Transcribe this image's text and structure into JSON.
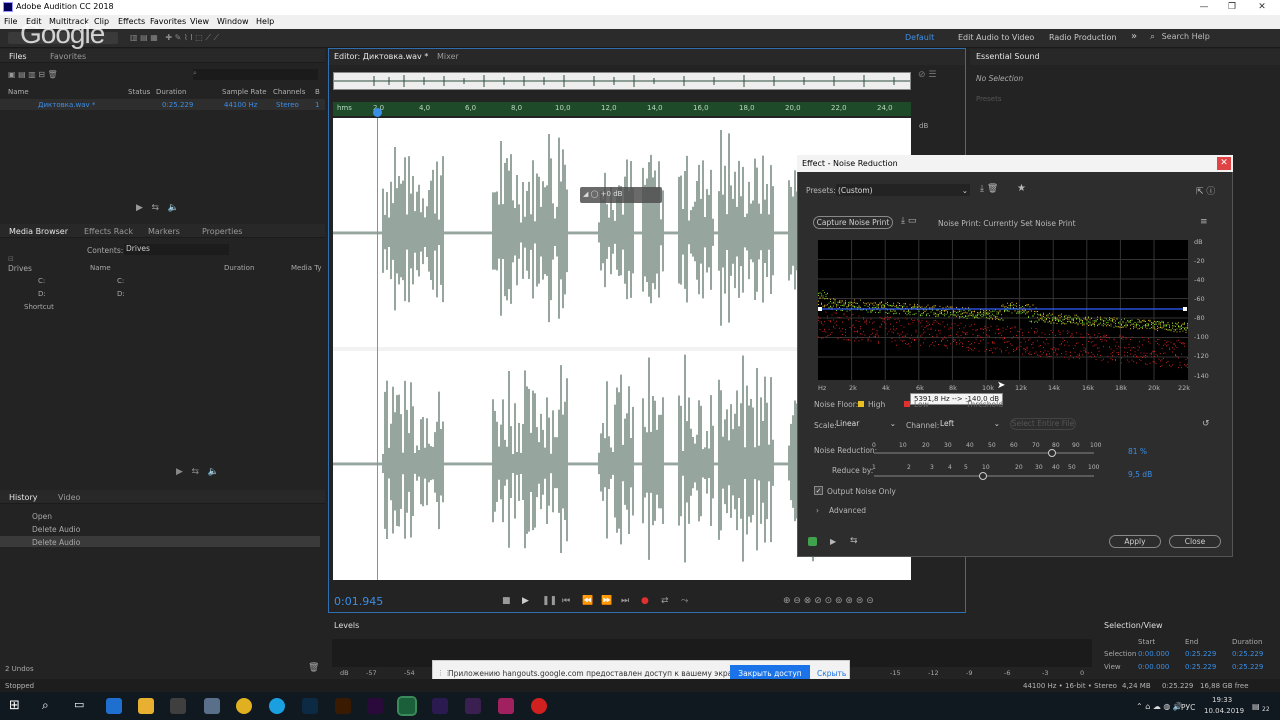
{
  "window": {
    "title": "Adobe Audition CC 2018",
    "minimize": "—",
    "maximize": "❐",
    "close": "✕"
  },
  "menu": [
    "File",
    "Edit",
    "Multitrack",
    "Clip",
    "Effects",
    "Favorites",
    "View",
    "Window",
    "Help"
  ],
  "toolbar": {
    "workspace_default": "Default",
    "workspace_edit": "Edit Audio to Video",
    "workspace_radio": "Radio Production",
    "overflow": "»",
    "search_placeholder": "Search Help",
    "overlay_text": "Google"
  },
  "files_panel": {
    "tab_files": "Files",
    "tab_favorites": "Favorites",
    "col_name": "Name",
    "col_status": "Status",
    "col_duration": "Duration",
    "col_sample_rate": "Sample Rate",
    "col_channels": "Channels",
    "col_bits": "B",
    "row": {
      "name": "Диктовка.wav *",
      "duration": "0:25.229",
      "sample_rate": "44100 Hz",
      "channels": "Stereo",
      "bits": "1"
    }
  },
  "media_browser": {
    "tab_media": "Media Browser",
    "tab_effects": "Effects Rack",
    "tab_markers": "Markers",
    "tab_properties": "Properties",
    "contents_label": "Contents:",
    "contents_value": "Drives",
    "tree": [
      "Drives",
      "C:",
      "D:",
      "Shortcut"
    ],
    "col_name": "Name",
    "col_duration": "Duration",
    "col_media": "Media Ty",
    "items": [
      "C:",
      "D:"
    ]
  },
  "history": {
    "tab_history": "History",
    "tab_video": "Video",
    "items": [
      "Open",
      "Delete Audio",
      "Delete Audio"
    ],
    "undos": "2 Undos"
  },
  "editor": {
    "tab_editor": "Editor: Диктовка.wav *",
    "tab_mixer": "Mixer",
    "ruler": [
      "hms",
      "2,0",
      "4,0",
      "6,0",
      "8,0",
      "10,0",
      "12,0",
      "14,0",
      "16,0",
      "18,0",
      "20,0",
      "22,0",
      "24,0"
    ],
    "hud_db": "+0 dB",
    "db_label": "dB",
    "time": "0:01.945"
  },
  "essential": {
    "title": "Essential Sound",
    "status": "No Selection",
    "preset": "Presets"
  },
  "noise_reduction": {
    "title": "Effect - Noise Reduction",
    "close": "✕",
    "presets_label": "Presets:",
    "presets_value": "(Custom)",
    "capture_btn": "Capture Noise Print",
    "noise_print": "Noise Print: Currently Set Noise Print",
    "freq_axis": [
      "Hz",
      "2k",
      "4k",
      "6k",
      "8k",
      "10k",
      "12k",
      "14k",
      "16k",
      "18k",
      "20k",
      "22k"
    ],
    "db_axis": [
      "dB",
      "-20",
      "-40",
      "-60",
      "-80",
      "-100",
      "-120",
      "-140"
    ],
    "tooltip": "5391,8 Hz --> -140,0 dB",
    "noise_floor_label": "Noise Floor:",
    "high": "High",
    "low": "Low",
    "threshold": "Threshold",
    "scale_label": "Scale:",
    "scale_value": "Linear",
    "channel_label": "Channel:",
    "channel_value": "Left",
    "select_entire": "Select Entire File",
    "nr_label": "Noise Reduction:",
    "nr_value": "81 %",
    "nr_scale": [
      "0",
      "10",
      "20",
      "30",
      "40",
      "50",
      "60",
      "70",
      "80",
      "90",
      "100"
    ],
    "reduce_label": "Reduce by:",
    "reduce_value": "9,5 dB",
    "reduce_scale": [
      "1",
      "2",
      "3",
      "4",
      "5",
      "10",
      "20",
      "30",
      "40",
      "50",
      "100"
    ],
    "output_only": "Output Noise Only",
    "advanced": "Advanced",
    "apply": "Apply",
    "close_btn": "Close",
    "high_color": "#e8c020",
    "low_color": "#e03030",
    "threshold_color": "#3060ff"
  },
  "levels": {
    "title": "Levels",
    "scale": [
      "dB",
      "-57",
      "-54",
      "-15",
      "-12",
      "-9",
      "-6",
      "-3",
      "0"
    ]
  },
  "selection_view": {
    "title": "Selection/View",
    "col_start": "Start",
    "col_end": "End",
    "col_duration": "Duration",
    "selection": {
      "label": "Selection",
      "start": "0:00.000",
      "end": "0:25.229",
      "duration": "0:25.229"
    },
    "view": {
      "label": "View",
      "start": "0:00.000",
      "end": "0:25.229",
      "duration": "0:25.229"
    }
  },
  "status": {
    "left": "Stopped",
    "format": "44100 Hz • 16-bit • Stereo",
    "size": "4,24 MB",
    "duration": "0:25.229",
    "free": "16,88 GB free"
  },
  "share_bar": {
    "message": "Приложению hangouts.google.com предоставлен доступ к вашему экрану.",
    "stop": "Закрыть доступ",
    "hide": "Скрыть"
  },
  "taskbar": {
    "lang": "РУС",
    "time": "19:33",
    "date": "10.04.2019",
    "badge": "22"
  }
}
